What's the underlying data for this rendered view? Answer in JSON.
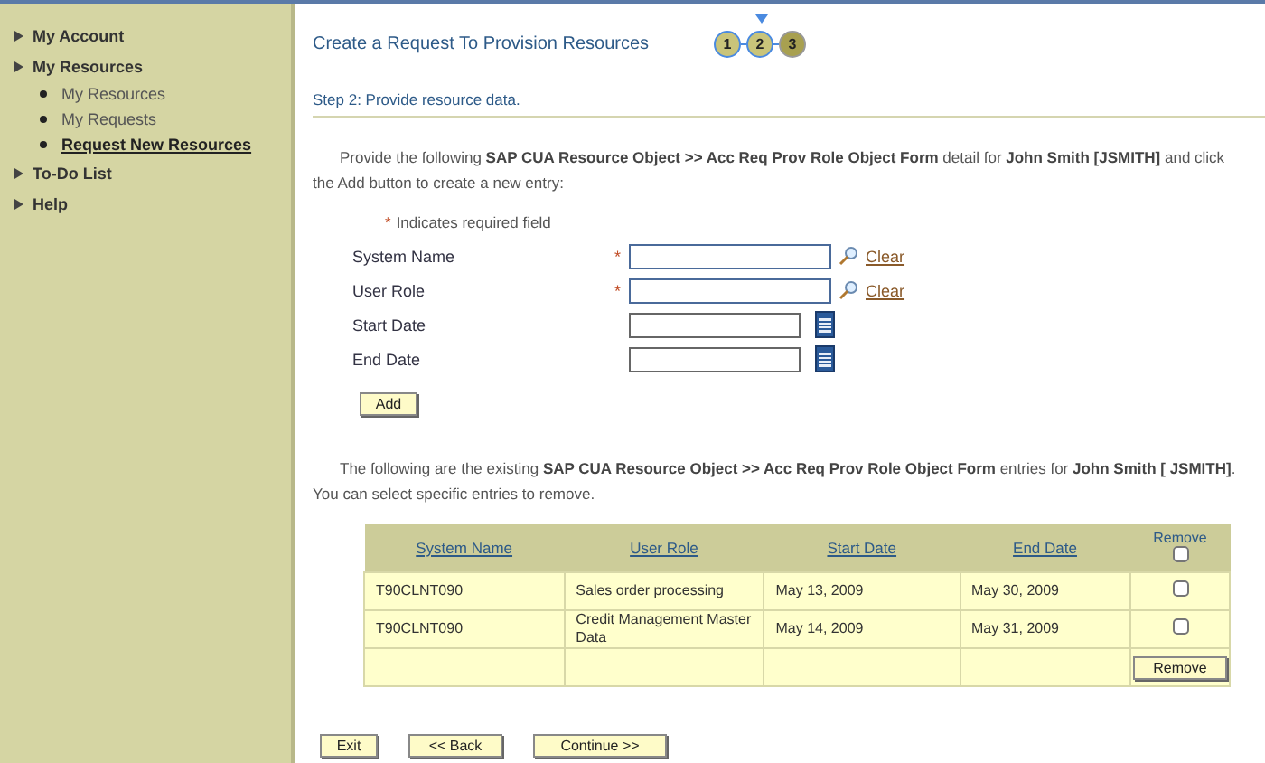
{
  "sidebar": {
    "items": [
      {
        "label": "My Account"
      },
      {
        "label": "My Resources",
        "children": [
          {
            "label": "My Resources",
            "selected": false
          },
          {
            "label": "My Requests",
            "selected": false
          },
          {
            "label": "Request New Resources",
            "selected": true
          }
        ]
      },
      {
        "label": "To-Do List"
      },
      {
        "label": "Help"
      }
    ]
  },
  "header": {
    "title": "Create a Request To Provision Resources",
    "steps": [
      {
        "label": "1",
        "reached": true,
        "selected": false
      },
      {
        "label": "2",
        "reached": true,
        "selected": true
      },
      {
        "label": "3",
        "reached": false,
        "selected": false
      }
    ]
  },
  "step_title": "Step 2:  Provide resource data.",
  "intro": "Provide the following **SAP CUA Resource Object >> Acc Req Prov Role Object Form** detail for **John Smith [JSMITH]** and click the Add button to create a new entry:",
  "required_note": {
    "mark": "*",
    "text": "Indicates required field"
  },
  "fields": [
    {
      "label": "System Name",
      "required": true,
      "kind": "lookup",
      "link": "Clear"
    },
    {
      "label": "User Role",
      "required": true,
      "kind": "lookup",
      "link": "Clear"
    },
    {
      "label": "Start Date",
      "required": false,
      "kind": "date"
    },
    {
      "label": "End Date",
      "required": false,
      "kind": "date"
    }
  ],
  "add_button": "Add",
  "existing_intro": "The following are the existing **SAP CUA Resource Object >> Acc Req Prov Role Object Form** entries for **John Smith [ JSMITH]**. You can select specific entries to remove.",
  "table": {
    "columns": [
      "System Name",
      "User Role",
      "Start Date",
      "End Date"
    ],
    "remove_column": {
      "label": "Remove",
      "checked": false
    },
    "rows": [
      {
        "cells": [
          "T90CLNT090",
          "Sales order processing",
          "May 13, 2009",
          "May 30, 2009"
        ],
        "checked": false
      },
      {
        "cells": [
          "T90CLNT090",
          "Credit Management Master Data",
          "May 14, 2009",
          "May 31, 2009"
        ],
        "checked": false
      }
    ],
    "remove_button": "Remove"
  },
  "buttons": [
    "Exit",
    "<< Back",
    "Continue >>"
  ]
}
